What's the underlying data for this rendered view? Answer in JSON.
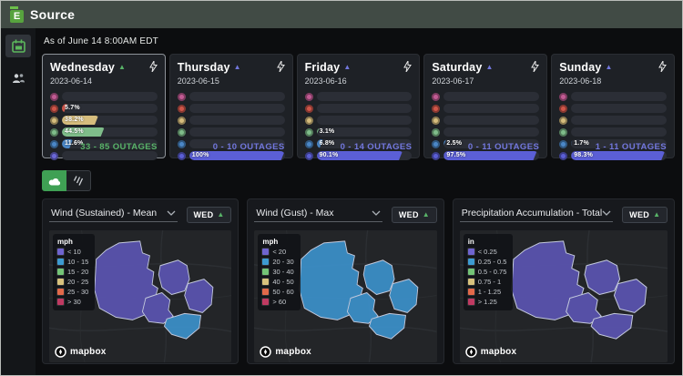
{
  "header": {
    "brand": "Source",
    "as_of": "As of June 14 8:00AM EDT"
  },
  "sidebar": {
    "items": [
      {
        "name": "calendar",
        "active": true
      },
      {
        "name": "users",
        "active": false
      }
    ]
  },
  "day_cards": [
    {
      "day": "Wednesday",
      "date": "2023-06-14",
      "trend_color": "#58b368",
      "selected": true,
      "outages": "33 - 85 OUTAGES",
      "outages_color": "#58b368",
      "bars": [
        {
          "level": "pink",
          "color": "#c25b94",
          "pct": 0,
          "label": ""
        },
        {
          "level": "red",
          "color": "#d0564a",
          "pct": 5.7,
          "label": "5.7%"
        },
        {
          "level": "yellow",
          "color": "#d6bd7d",
          "pct": 38.2,
          "label": "38.2%"
        },
        {
          "level": "green",
          "color": "#7fbd8a",
          "pct": 44.5,
          "label": "44.5%"
        },
        {
          "level": "blue",
          "color": "#4b87c7",
          "pct": 11.6,
          "label": "11.6%"
        },
        {
          "level": "purple",
          "color": "#6b68d8",
          "pct": 0,
          "label": ""
        }
      ]
    },
    {
      "day": "Thursday",
      "date": "2023-06-15",
      "trend_color": "#7277dd",
      "selected": false,
      "outages": "0 - 10 OUTAGES",
      "outages_color": "#7277dd",
      "bars": [
        {
          "level": "pink",
          "color": "#c25b94",
          "pct": 0,
          "label": ""
        },
        {
          "level": "red",
          "color": "#d0564a",
          "pct": 0,
          "label": ""
        },
        {
          "level": "yellow",
          "color": "#d6bd7d",
          "pct": 0,
          "label": ""
        },
        {
          "level": "green",
          "color": "#7fbd8a",
          "pct": 0,
          "label": ""
        },
        {
          "level": "blue",
          "color": "#4b87c7",
          "pct": 0,
          "label": ""
        },
        {
          "level": "purple",
          "color": "#5b5fd6",
          "pct": 100,
          "label": "100%"
        }
      ]
    },
    {
      "day": "Friday",
      "date": "2023-06-16",
      "trend_color": "#7277dd",
      "selected": false,
      "outages": "0 - 14 OUTAGES",
      "outages_color": "#7277dd",
      "bars": [
        {
          "level": "pink",
          "color": "#c25b94",
          "pct": 0,
          "label": ""
        },
        {
          "level": "red",
          "color": "#d0564a",
          "pct": 0,
          "label": ""
        },
        {
          "level": "yellow",
          "color": "#d6bd7d",
          "pct": 0,
          "label": ""
        },
        {
          "level": "green",
          "color": "#7fbd8a",
          "pct": 3.1,
          "label": "3.1%"
        },
        {
          "level": "blue",
          "color": "#4b87c7",
          "pct": 6.8,
          "label": "6.8%"
        },
        {
          "level": "purple",
          "color": "#5b5fd6",
          "pct": 90.1,
          "label": "90.1%"
        }
      ]
    },
    {
      "day": "Saturday",
      "date": "2023-06-17",
      "trend_color": "#7277dd",
      "selected": false,
      "outages": "0 - 11 OUTAGES",
      "outages_color": "#7277dd",
      "bars": [
        {
          "level": "pink",
          "color": "#c25b94",
          "pct": 0,
          "label": ""
        },
        {
          "level": "red",
          "color": "#d0564a",
          "pct": 0,
          "label": ""
        },
        {
          "level": "yellow",
          "color": "#d6bd7d",
          "pct": 0,
          "label": ""
        },
        {
          "level": "green",
          "color": "#7fbd8a",
          "pct": 0,
          "label": ""
        },
        {
          "level": "blue",
          "color": "#4b87c7",
          "pct": 2.5,
          "label": "2.5%"
        },
        {
          "level": "purple",
          "color": "#5b5fd6",
          "pct": 97.5,
          "label": "97.5%"
        }
      ]
    },
    {
      "day": "Sunday",
      "date": "2023-06-18",
      "trend_color": "#7277dd",
      "selected": false,
      "outages": "1 - 11 OUTAGES",
      "outages_color": "#7277dd",
      "bars": [
        {
          "level": "pink",
          "color": "#c25b94",
          "pct": 0,
          "label": ""
        },
        {
          "level": "red",
          "color": "#d0564a",
          "pct": 0,
          "label": ""
        },
        {
          "level": "yellow",
          "color": "#d6bd7d",
          "pct": 0,
          "label": ""
        },
        {
          "level": "green",
          "color": "#7fbd8a",
          "pct": 0,
          "label": ""
        },
        {
          "level": "blue",
          "color": "#4b87c7",
          "pct": 1.7,
          "label": "1.7%"
        },
        {
          "level": "purple",
          "color": "#5b5fd6",
          "pct": 98.3,
          "label": "98.3%"
        }
      ]
    }
  ],
  "maps": [
    {
      "title": "Wind (Sustained) - Mean",
      "day_badge": "WED",
      "legend_title": "mph",
      "legend": [
        {
          "label": "< 10",
          "color": "#6f64cf"
        },
        {
          "label": "10 - 15",
          "color": "#3d9bd1"
        },
        {
          "label": "15 - 20",
          "color": "#74c476"
        },
        {
          "label": "20 - 25",
          "color": "#d8c27d"
        },
        {
          "label": "25 - 30",
          "color": "#e2694a"
        },
        {
          "label": "> 30",
          "color": "#c03a62"
        }
      ],
      "region_fills": [
        "#5953ad",
        "#5953ad",
        "#5953ad",
        "#5953ad",
        "#3b8ec6"
      ],
      "attribution": "mapbox"
    },
    {
      "title": "Wind (Gust) - Max",
      "day_badge": "WED",
      "legend_title": "mph",
      "legend": [
        {
          "label": "< 20",
          "color": "#6f64cf"
        },
        {
          "label": "20 - 30",
          "color": "#3d9bd1"
        },
        {
          "label": "30 - 40",
          "color": "#74c476"
        },
        {
          "label": "40 - 50",
          "color": "#d8c27d"
        },
        {
          "label": "50 - 60",
          "color": "#e2694a"
        },
        {
          "label": "> 60",
          "color": "#c03a62"
        }
      ],
      "region_fills": [
        "#3b8ec6",
        "#3b8ec6",
        "#3b8ec6",
        "#3b8ec6",
        "#3b8ec6"
      ],
      "attribution": "mapbox"
    },
    {
      "title": "Precipitation Accumulation - Total",
      "day_badge": "WED",
      "legend_title": "in",
      "legend": [
        {
          "label": "< 0.25",
          "color": "#6f64cf"
        },
        {
          "label": "0.25 - 0.5",
          "color": "#3d9bd1"
        },
        {
          "label": "0.5 - 0.75",
          "color": "#74c476"
        },
        {
          "label": "0.75 - 1",
          "color": "#d8c27d"
        },
        {
          "label": "1 - 1.25",
          "color": "#e2694a"
        },
        {
          "label": "> 1.25",
          "color": "#c03a62"
        }
      ],
      "region_fills": [
        "#5953ad",
        "#5953ad",
        "#5953ad",
        "#5953ad",
        "#5953ad"
      ],
      "attribution": "mapbox"
    }
  ]
}
